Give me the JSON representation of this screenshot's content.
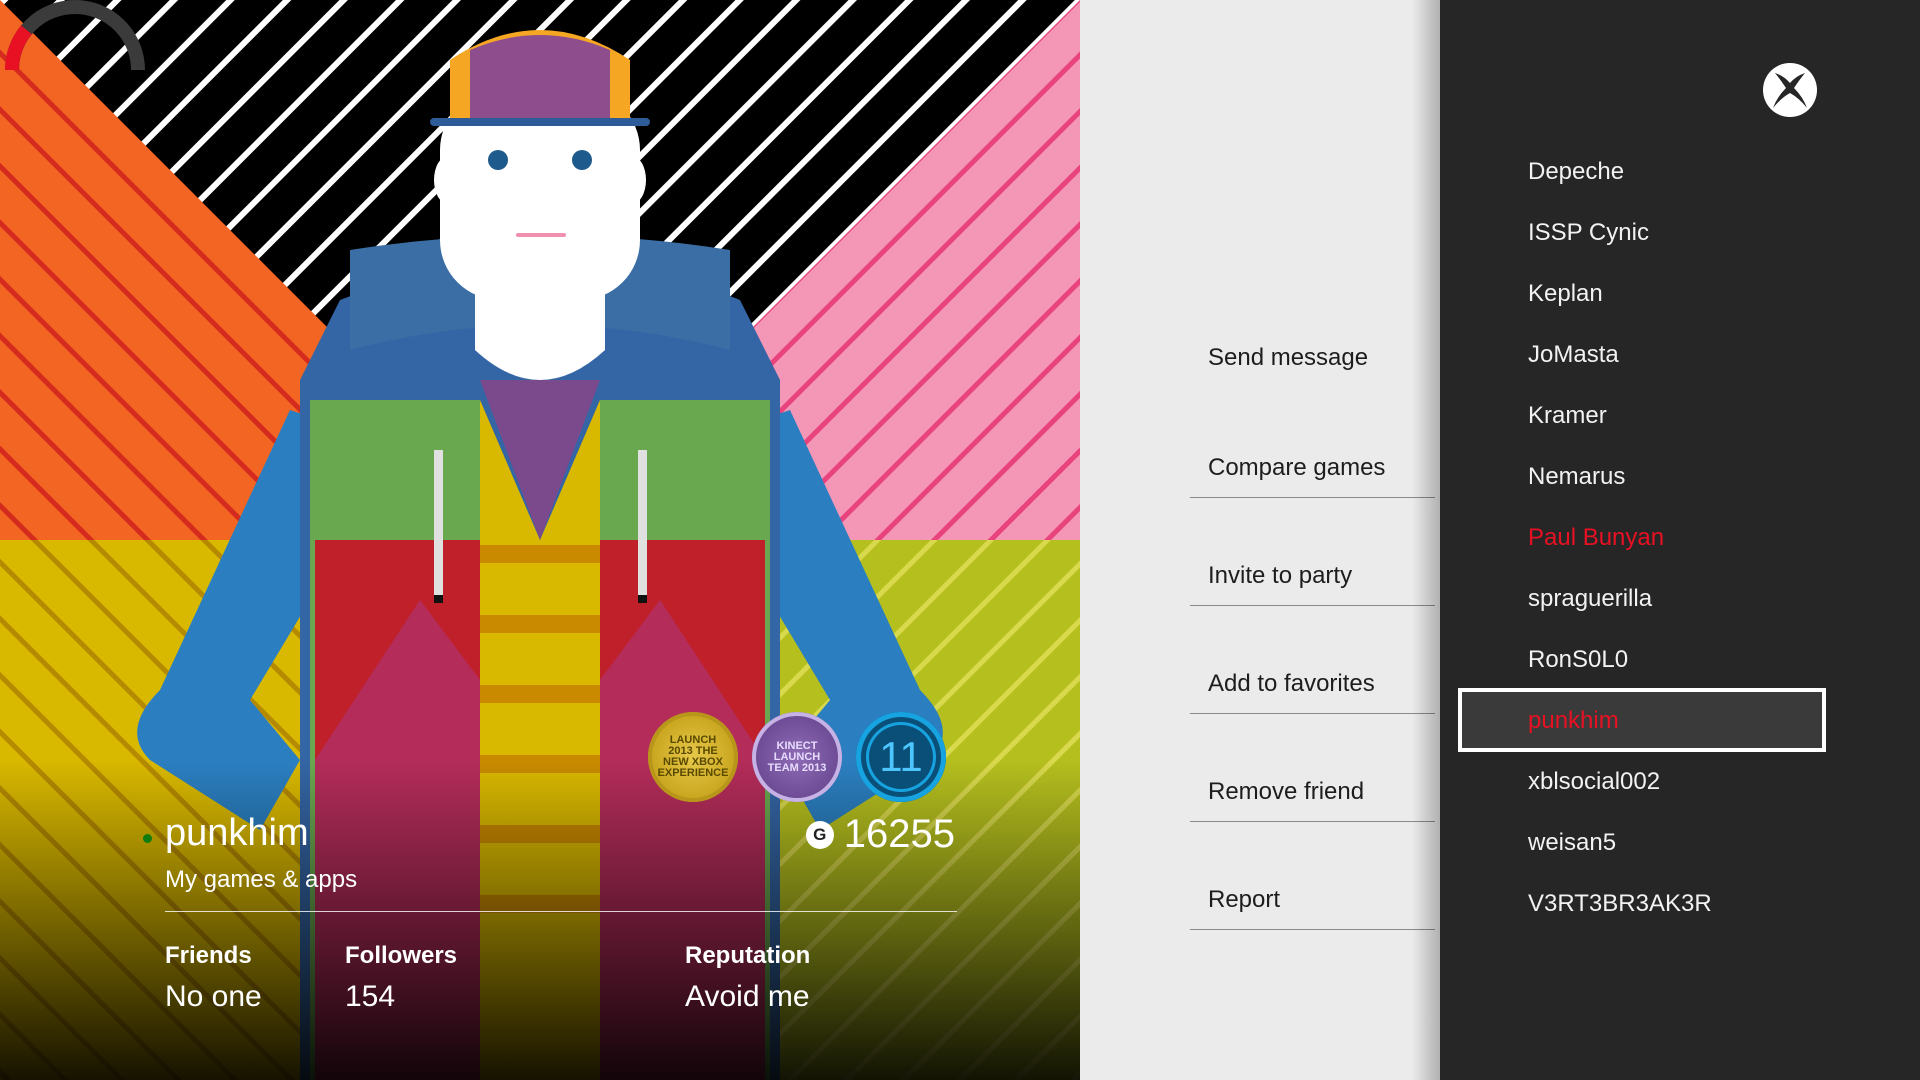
{
  "profile": {
    "gamertag": "punkhim",
    "subtitle": "My games & apps",
    "gamerscore": "16255",
    "gamerscore_icon": "G",
    "badges": [
      {
        "name": "launch-2013-badge",
        "text": "LAUNCH 2013 THE NEW XBOX EXPERIENCE"
      },
      {
        "name": "kinect-launch-team-badge",
        "text": "KINECT LAUNCH TEAM 2013"
      },
      {
        "name": "level-badge",
        "text": "11"
      }
    ],
    "stats": {
      "friends_label": "Friends",
      "friends_value": "No one",
      "followers_label": "Followers",
      "followers_value": "154",
      "reputation_label": "Reputation",
      "reputation_value": "Avoid me"
    },
    "reputation_level": 0.22,
    "colors": {
      "online": "#107c10",
      "reputation_bad": "#e81123"
    }
  },
  "menu": {
    "items": [
      "Send message",
      "Compare games",
      "Invite to party",
      "Add to favorites",
      "Remove friend",
      "Report"
    ]
  },
  "friends": {
    "items": [
      {
        "name": "Depeche",
        "color": "white"
      },
      {
        "name": "ISSP Cynic",
        "color": "white"
      },
      {
        "name": "Keplan",
        "color": "white"
      },
      {
        "name": "JoMasta",
        "color": "white"
      },
      {
        "name": "Kramer",
        "color": "white"
      },
      {
        "name": "Nemarus",
        "color": "white"
      },
      {
        "name": "Paul Bunyan",
        "color": "red"
      },
      {
        "name": "spraguerilla",
        "color": "white"
      },
      {
        "name": "RonS0L0",
        "color": "white"
      },
      {
        "name": "punkhim",
        "color": "red",
        "selected": true
      },
      {
        "name": "xblsocial002",
        "color": "white"
      },
      {
        "name": "weisan5",
        "color": "white"
      },
      {
        "name": "V3RT3BR3AK3R",
        "color": "white"
      }
    ],
    "selected_index": 9
  },
  "icons": {
    "logo": "xbox-logo-icon",
    "status": "online-status-icon",
    "gamerscore": "gamerscore-icon"
  }
}
